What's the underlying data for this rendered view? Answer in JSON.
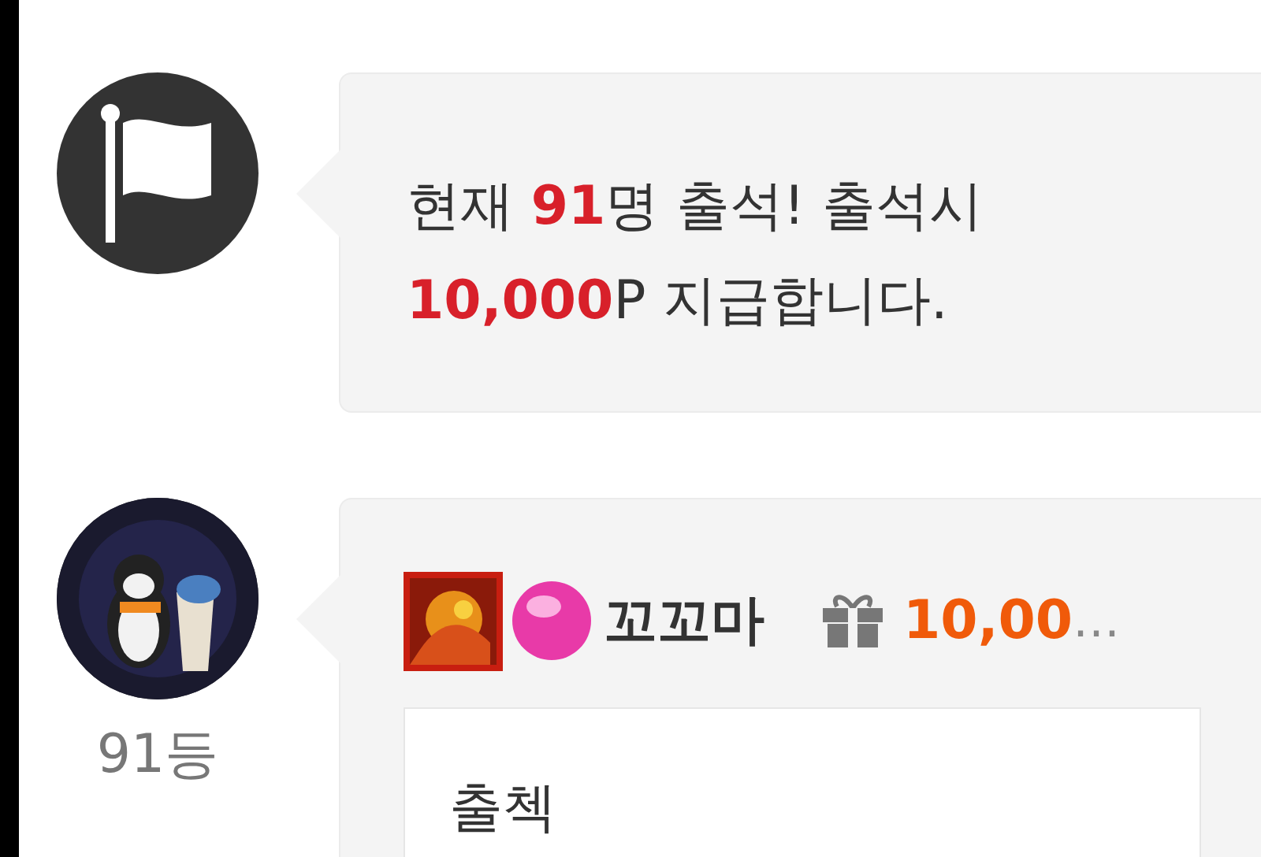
{
  "notice": {
    "lines": [
      [
        {
          "text": "현재 ",
          "highlight": false
        },
        {
          "text": "91",
          "highlight": true
        },
        {
          "text": "명 출석! 출석시",
          "highlight": false
        }
      ],
      [
        {
          "text": "10,000",
          "highlight": true
        },
        {
          "text": "P 지급합니다.",
          "highlight": false
        }
      ]
    ]
  },
  "entry": {
    "rank": "91등",
    "nickname": "꼬꼬마",
    "points": "10,00",
    "ellipsis": "…",
    "comment": "출첵"
  }
}
